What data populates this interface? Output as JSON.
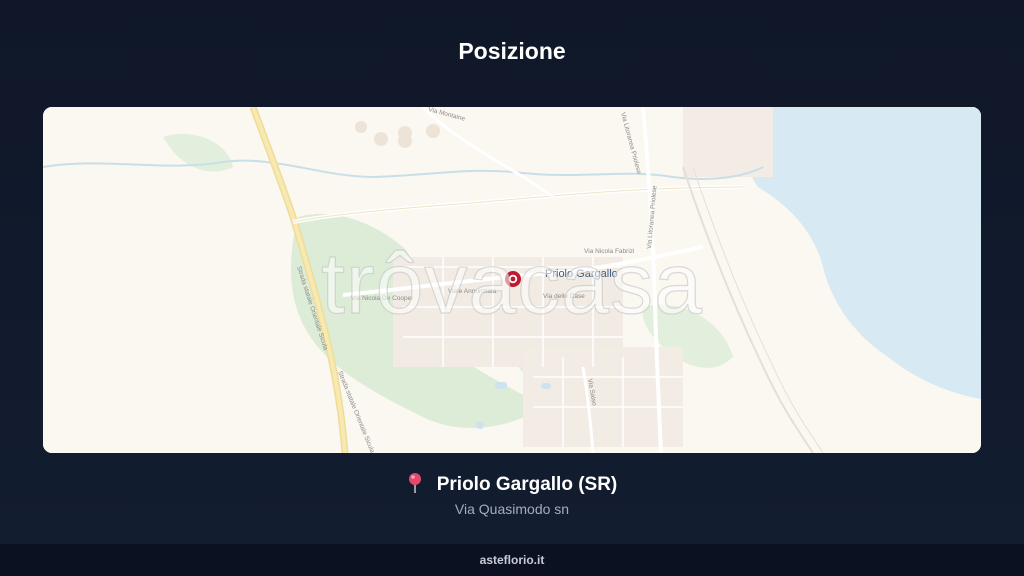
{
  "header": {
    "title": "Posizione"
  },
  "map": {
    "watermark": "trôvacasa",
    "place_label": "Priolo Gargallo",
    "street_labels": {
      "via_nicola_fabrizi": "Via Nicola Fabrizi",
      "via_annunziata": "Viale Annunziata",
      "via_nicola_de_cooper": "Via Nicola De Cooper",
      "via_delle_case": "Via delle Case",
      "via_salso": "Via Salso",
      "via_montaine": "Via Montaine",
      "via_litoranea_priolese_1": "Via Litoranea Priolese",
      "via_litoranea_priolese_2": "Via Litoranea Priolese",
      "strada_statale_1": "Strada statale Orientale Sicula",
      "strada_statale_2": "Strada statale Orientale Sicula"
    },
    "colors": {
      "land": "#fbf7f1",
      "sea": "#d7e9f2",
      "park": "#d9ead3",
      "road": "#f5e7a8",
      "marker": "#c0192e"
    }
  },
  "location": {
    "pin_icon": "round-pushpin",
    "name": "Priolo Gargallo (SR)",
    "address": "Via Quasimodo sn"
  },
  "footer": {
    "site": "asteflorio.it"
  }
}
